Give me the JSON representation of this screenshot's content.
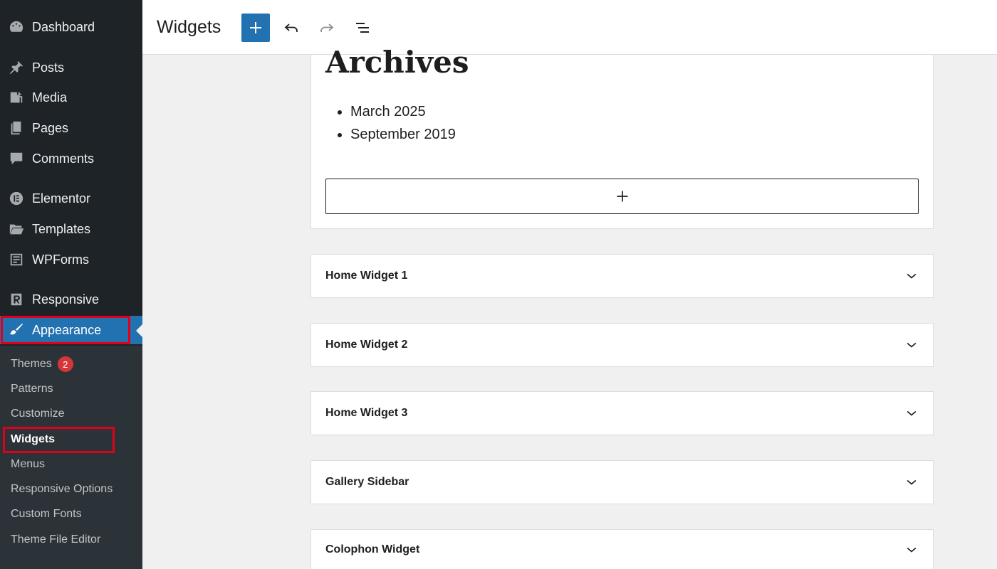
{
  "sidebar": {
    "menu": [
      {
        "label": "Dashboard",
        "icon": "dashboard-icon"
      },
      {
        "label": "Posts",
        "icon": "pin-icon"
      },
      {
        "label": "Media",
        "icon": "media-icon"
      },
      {
        "label": "Pages",
        "icon": "pages-icon"
      },
      {
        "label": "Comments",
        "icon": "comment-icon"
      },
      {
        "label": "Elementor",
        "icon": "elementor-icon"
      },
      {
        "label": "Templates",
        "icon": "folder-icon"
      },
      {
        "label": "WPForms",
        "icon": "wpforms-icon"
      },
      {
        "label": "Responsive",
        "icon": "responsive-icon"
      },
      {
        "label": "Appearance",
        "icon": "brush-icon"
      }
    ],
    "submenu": [
      {
        "label": "Themes",
        "badge": "2"
      },
      {
        "label": "Patterns"
      },
      {
        "label": "Customize"
      },
      {
        "label": "Widgets"
      },
      {
        "label": "Menus"
      },
      {
        "label": "Responsive Options"
      },
      {
        "label": "Custom Fonts"
      },
      {
        "label": "Theme File Editor"
      }
    ],
    "active_color": "#2271b1",
    "highlight_color": "#e1001a"
  },
  "header": {
    "title": "Widgets"
  },
  "archives": {
    "title": "Archives",
    "items": [
      "March 2025",
      "September 2019"
    ]
  },
  "widget_areas": [
    {
      "title": "Home Widget 1"
    },
    {
      "title": "Home Widget 2"
    },
    {
      "title": "Home Widget 3"
    },
    {
      "title": "Gallery Sidebar"
    },
    {
      "title": "Colophon Widget"
    }
  ]
}
